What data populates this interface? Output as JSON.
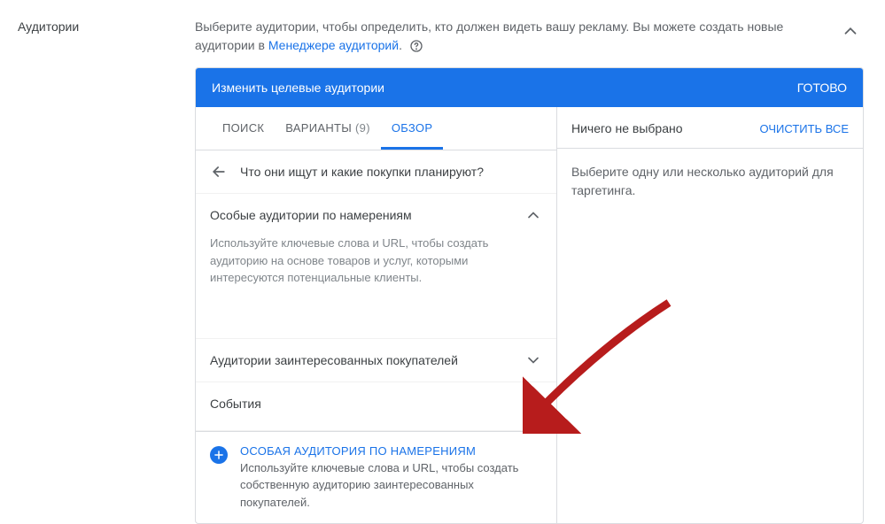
{
  "sidebar": {
    "label": "Аудитории"
  },
  "intro": {
    "text1": "Выберите аудитории, чтобы определить, кто должен видеть вашу рекламу.  Вы можете создать новые аудитории в ",
    "link": "Менеджере аудиторий",
    "period": "."
  },
  "card": {
    "title": "Изменить целевые аудитории",
    "doneLabel": "ГОТОВО"
  },
  "tabs": {
    "search": "ПОИСК",
    "variants": "ВАРИАНТЫ",
    "variantsCount": "(9)",
    "overview": "ОБЗОР"
  },
  "breadcrumb": {
    "text": "Что они ищут и какие покупки планируют?"
  },
  "accordion": {
    "intent": {
      "title": "Особые аудитории по намерениям",
      "desc": "Используйте ключевые слова и URL, чтобы создать аудиторию на основе товаров и услуг, которыми интересуются потенциальные клиенты."
    },
    "inmarket": {
      "title": "Аудитории заинтересованных покупателей"
    },
    "events": {
      "title": "События"
    }
  },
  "right": {
    "none": "Ничего не выбрано",
    "clear": "ОЧИСТИТЬ ВСЕ",
    "helper": "Выберите одну или несколько аудиторий для таргетинга."
  },
  "customIntent": {
    "title": "ОСОБАЯ АУДИТОРИЯ ПО НАМЕРЕНИЯМ",
    "desc": "Используйте ключевые слова и URL, чтобы создать собственную аудиторию заинтересованных покупателей."
  }
}
